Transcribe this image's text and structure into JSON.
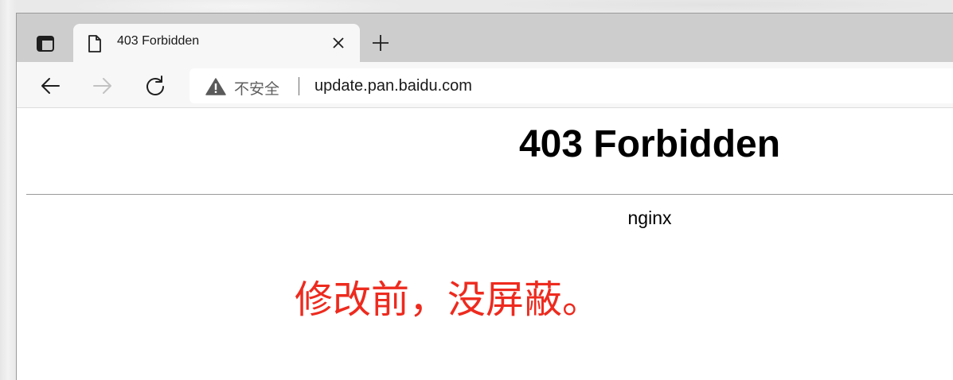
{
  "browser": {
    "tab": {
      "title": "403 Forbidden"
    },
    "addressbar": {
      "security_label": "不安全",
      "url": "update.pan.baidu.com"
    }
  },
  "page": {
    "heading": "403 Forbidden",
    "server": "nginx"
  },
  "annotation": {
    "text": "修改前，没屏蔽。",
    "color": "#ee2a1e"
  }
}
